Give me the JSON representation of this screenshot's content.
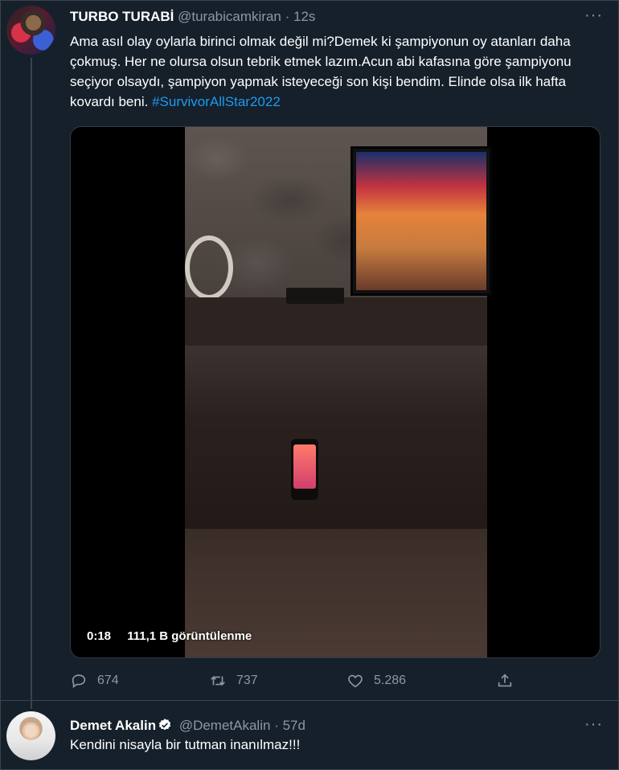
{
  "tweet1": {
    "display_name": "TURBO TURABİ",
    "handle": "@turabicamkiran",
    "separator": "·",
    "time": "12s",
    "text": "Ama asıl olay oylarla birinci olmak değil mi?Demek ki şampiyonun oy atanları daha çokmuş. Her ne olursa olsun tebrik etmek lazım.Acun abi kafasına göre şampiyonu seçiyor olsaydı, şampiyon yapmak isteyeceği son kişi bendim. Elinde olsa ilk hafta kovardı beni.",
    "hashtag": "#SurvivorAllStar2022",
    "more_label": "···",
    "video": {
      "duration": "0:18",
      "views": "111,1 B görüntülenme"
    },
    "actions": {
      "replies": "674",
      "retweets": "737",
      "likes": "5.286"
    }
  },
  "tweet2": {
    "display_name": "Demet Akalin",
    "handle": "@DemetAkalin",
    "separator": "·",
    "time": "57d",
    "text": "Kendini nisayla bir tutman inanılmaz!!!",
    "more_label": "···"
  },
  "icons": {
    "reply": "reply-icon",
    "retweet": "retweet-icon",
    "like": "heart-icon",
    "share": "share-icon",
    "verified": "verified-badge-icon",
    "more": "more-icon"
  },
  "colors": {
    "background": "#15202b",
    "text": "#ffffff",
    "muted": "#8899a6",
    "link": "#1d9bf0",
    "border": "#38444d"
  }
}
